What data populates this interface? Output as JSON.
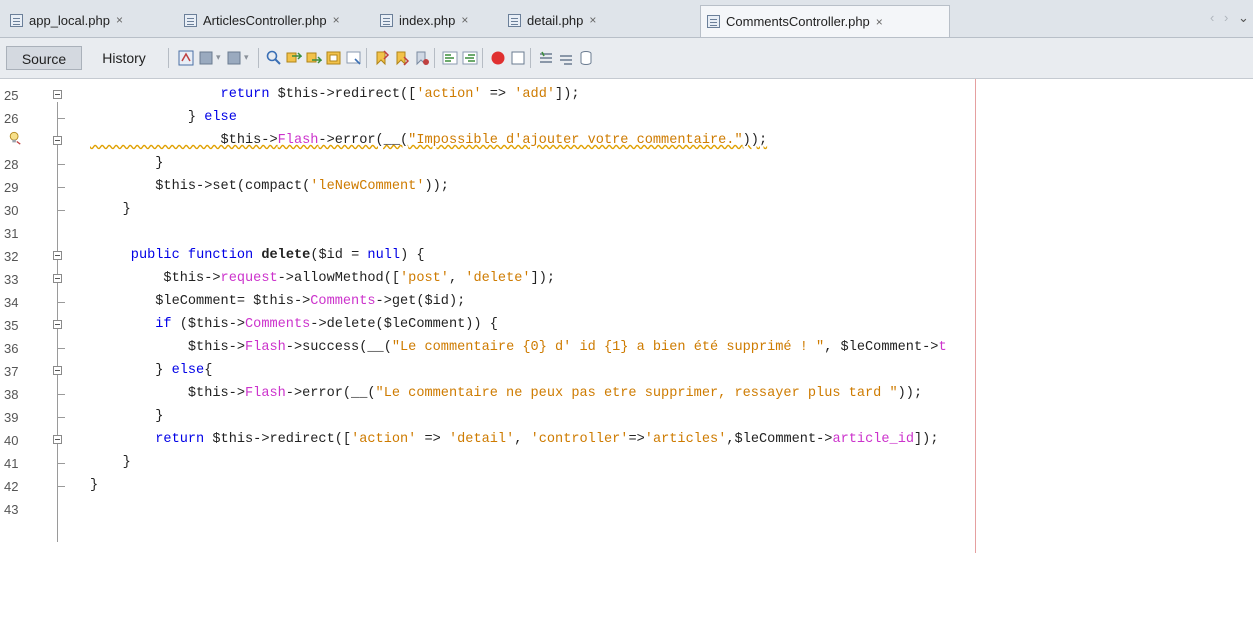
{
  "tabs": [
    {
      "label": "app_local.php",
      "active": false
    },
    {
      "label": "ArticlesController.php",
      "active": false
    },
    {
      "label": "index.php",
      "active": false
    },
    {
      "label": "detail.php",
      "active": false
    },
    {
      "label": "CommentsController.php",
      "active": true
    }
  ],
  "tab_close_glyph": "×",
  "tab_nav": {
    "prev": "‹",
    "next": "›",
    "menu": "⌄"
  },
  "toolbar": {
    "source_label": "Source",
    "history_label": "History",
    "icons": [
      "last-edit-icon",
      "back-icon",
      "forward-icon",
      "find-icon",
      "find-previous-icon",
      "find-next-icon",
      "find-selection-icon",
      "toggle-highlight-icon",
      "previous-bookmark-icon",
      "next-bookmark-icon",
      "toggle-bookmark-icon",
      "shift-left-icon",
      "shift-right-icon",
      "start-macro-icon",
      "stop-macro-icon",
      "comment-icon",
      "uncomment-icon",
      "database-icon"
    ]
  },
  "colors": {
    "keyword": "#0000e6",
    "string": "#ce7b00",
    "property": "#cc33cc",
    "margin_line": "#e5a0a0"
  },
  "lines": [
    {
      "n": "25",
      "fold": true,
      "text": "                return $this->redirect(['action' => 'add']);"
    },
    {
      "n": "26",
      "fold": false,
      "text": "            } else"
    },
    {
      "n": "27",
      "fold": true,
      "text": "                $this->Flash->error(__(\"Impossible d'ajouter votre commentaire.\"));"
    },
    {
      "n": "28",
      "fold": false,
      "text": "        }"
    },
    {
      "n": "29",
      "fold": false,
      "text": "        $this->set(compact('leNewComment'));"
    },
    {
      "n": "30",
      "fold": false,
      "text": "    }"
    },
    {
      "n": "31",
      "fold": false,
      "text": ""
    },
    {
      "n": "32",
      "fold": true,
      "text": "     public function delete($id = null) {"
    },
    {
      "n": "33",
      "fold": true,
      "text": "         $this->request->allowMethod(['post', 'delete']);"
    },
    {
      "n": "34",
      "fold": false,
      "text": "        $leComment= $this->Comments->get($id);"
    },
    {
      "n": "35",
      "fold": true,
      "text": "        if ($this->Comments->delete($leComment)) {"
    },
    {
      "n": "36",
      "fold": false,
      "text": "            $this->Flash->success(__(\"Le commentaire {0} d' id {1} a bien été supprimé ! \", $leComment->t"
    },
    {
      "n": "37",
      "fold": true,
      "text": "        } else{"
    },
    {
      "n": "38",
      "fold": false,
      "text": "            $this->Flash->error(__(\"Le commentaire ne peux pas etre supprimer, ressayer plus tard \"));"
    },
    {
      "n": "39",
      "fold": false,
      "text": "        }"
    },
    {
      "n": "40",
      "fold": true,
      "text": "        return $this->redirect(['action' => 'detail', 'controller'=>'articles',$leComment->article_id]);"
    },
    {
      "n": "41",
      "fold": false,
      "text": "    }"
    },
    {
      "n": "42",
      "fold": false,
      "text": "}"
    },
    {
      "n": "43",
      "fold": false,
      "text": ""
    }
  ],
  "warning_line": "27"
}
